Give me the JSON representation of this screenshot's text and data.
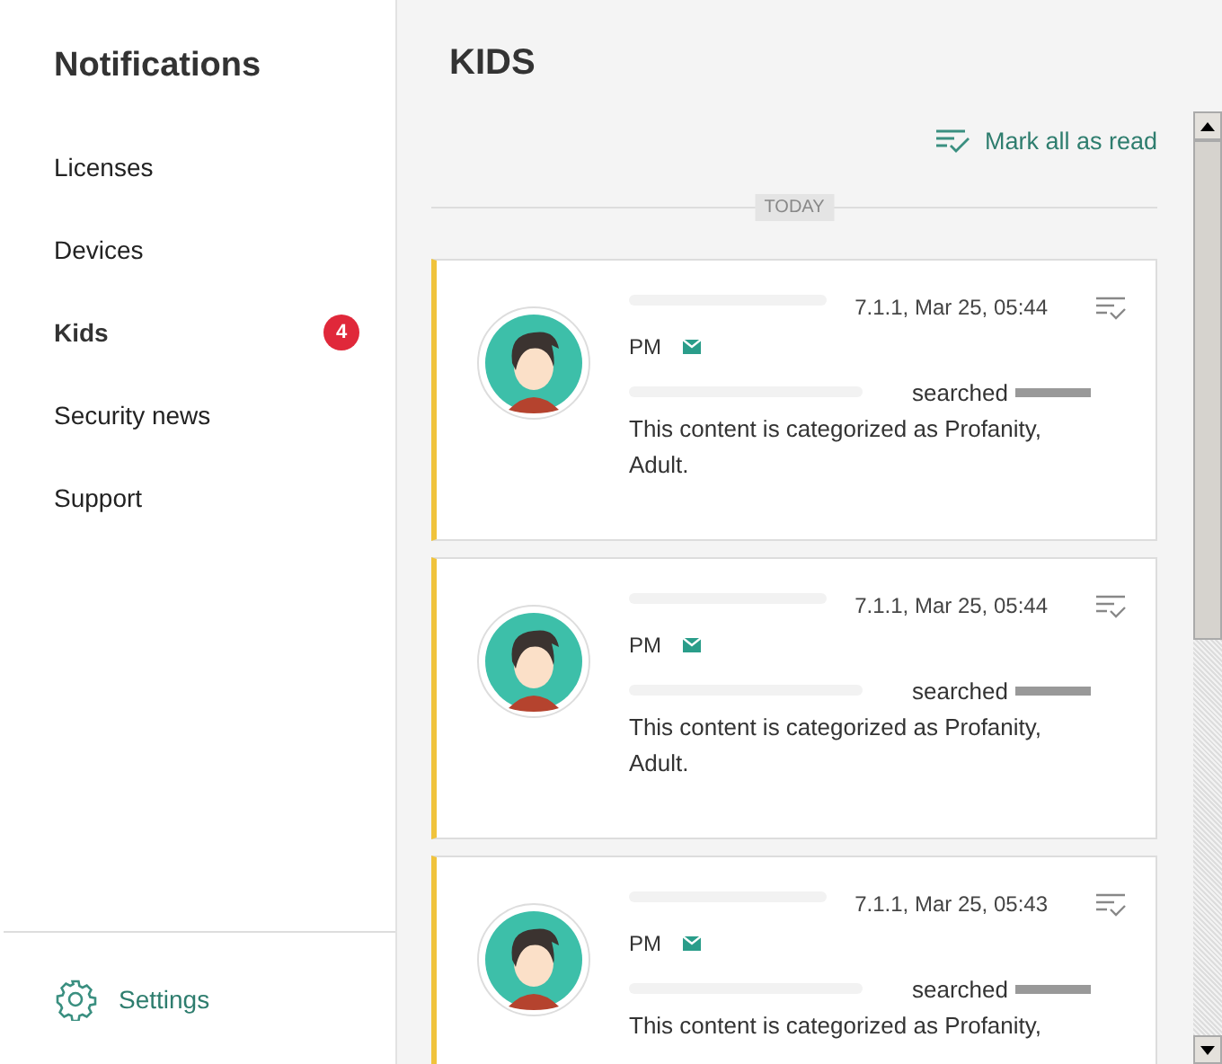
{
  "sidebar": {
    "title": "Notifications",
    "items": [
      {
        "label": "Licenses",
        "selected": false
      },
      {
        "label": "Devices",
        "selected": false
      },
      {
        "label": "Kids",
        "selected": true,
        "badge": "4"
      },
      {
        "label": "Security news",
        "selected": false
      },
      {
        "label": "Support",
        "selected": false
      }
    ],
    "settings": "Settings"
  },
  "main": {
    "title": "KIDS",
    "mark_all": "Mark all as read",
    "divider": "TODAY",
    "cards": [
      {
        "unread": true,
        "time": "7.1.1, Mar 25, 05:44",
        "time_end": "PM",
        "action": "searched",
        "message": "This content is categorized as Profanity, Adult."
      },
      {
        "unread": true,
        "time": "7.1.1, Mar 25, 05:44",
        "time_end": "PM",
        "action": "searched",
        "message": "This content is categorized as Profanity, Adult."
      },
      {
        "unread": true,
        "time": "7.1.1, Mar 25, 05:43",
        "time_end": "PM",
        "action": "searched",
        "message": "This content is categorized as Profanity,"
      }
    ]
  }
}
